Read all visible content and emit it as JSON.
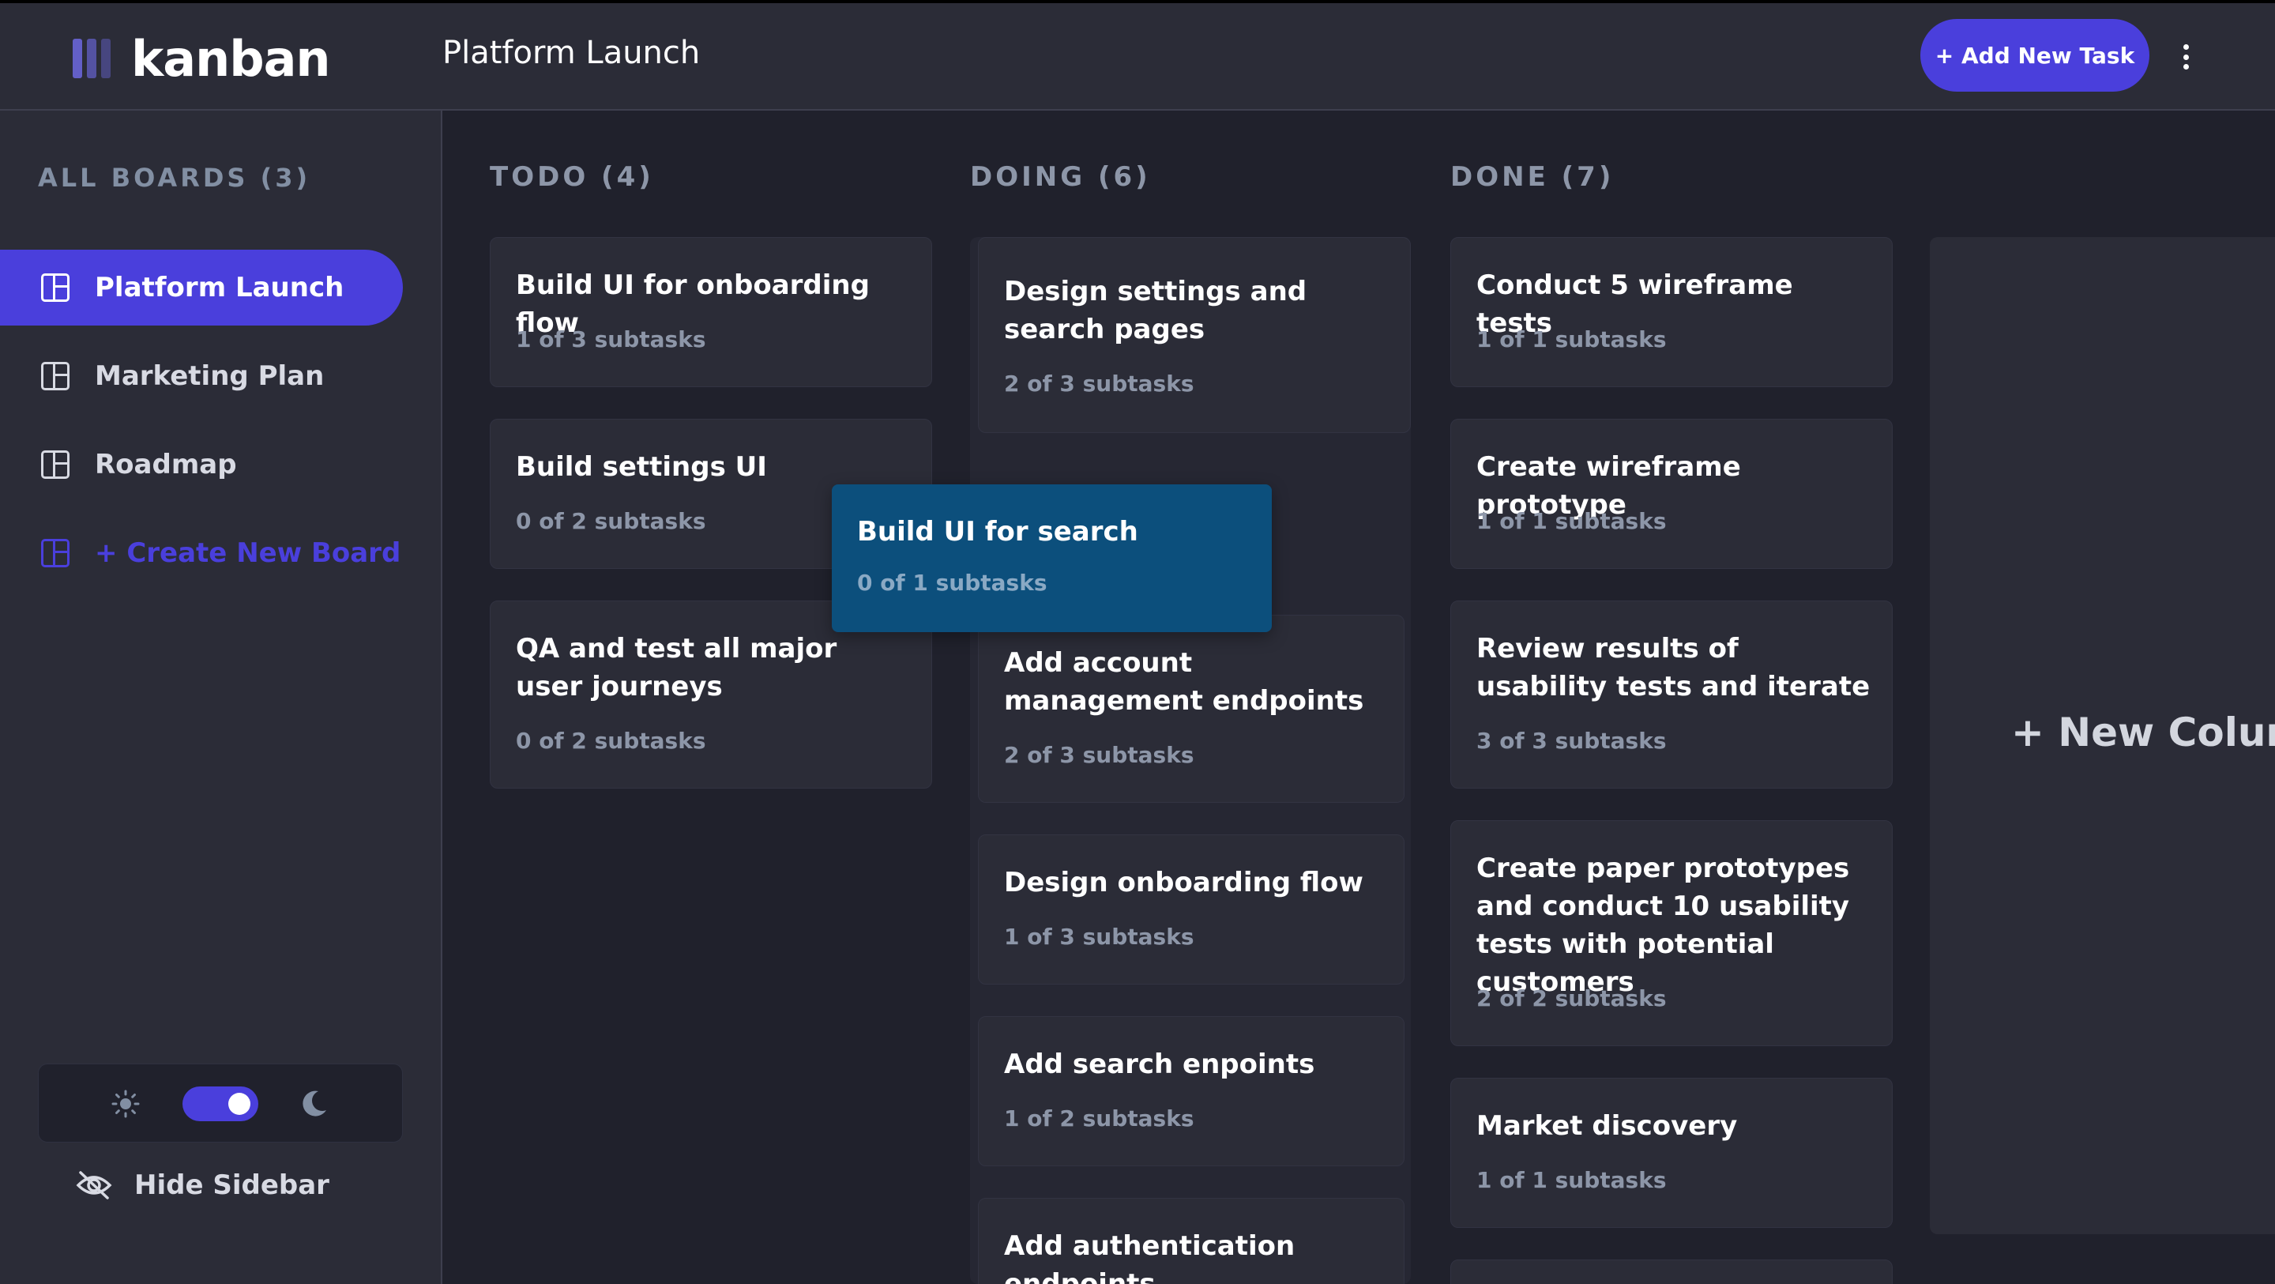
{
  "header": {
    "logo_text": "kanban",
    "board_title": "Platform Launch",
    "add_task_label": "+ Add New Task"
  },
  "sidebar": {
    "all_boards_label": "ALL BOARDS (3)",
    "boards": [
      "Platform Launch",
      "Marketing Plan",
      "Roadmap"
    ],
    "create_label": "+ Create New Board",
    "hide_label": "Hide Sidebar",
    "theme_mode": "dark"
  },
  "columns": [
    {
      "title": "TODO (4)",
      "cards": [
        {
          "title": "Build UI for onboarding flow",
          "sub": "1 of 3 subtasks"
        },
        {
          "title": "Build settings UI",
          "sub": "0 of 2 subtasks"
        },
        {
          "title": "QA and test all major user journeys",
          "sub": "0 of 2 subtasks"
        }
      ]
    },
    {
      "title": "DOING (6)",
      "cards": [
        {
          "title": "Design settings and search pages",
          "sub": "2 of 3 subtasks"
        },
        {
          "title": "Add account management endpoints",
          "sub": "2 of 3 subtasks"
        },
        {
          "title": "Design onboarding flow",
          "sub": "1 of 3 subtasks"
        },
        {
          "title": "Add search enpoints",
          "sub": "1 of 2 subtasks"
        },
        {
          "title": "Add authentication endpoints",
          "sub": ""
        }
      ]
    },
    {
      "title": "DONE (7)",
      "cards": [
        {
          "title": "Conduct 5 wireframe tests",
          "sub": "1 of 1 subtasks"
        },
        {
          "title": "Create wireframe prototype",
          "sub": "1 of 1 subtasks"
        },
        {
          "title": "Review results of usability tests and iterate",
          "sub": "3 of 3 subtasks"
        },
        {
          "title": "Create paper prototypes and conduct 10 usability tests with potential customers",
          "sub": "2 of 2 subtasks"
        },
        {
          "title": "Market discovery",
          "sub": "1 of 1 subtasks"
        }
      ]
    }
  ],
  "dragging_card": {
    "title": "Build UI for search",
    "sub": "0 of 1 subtasks"
  },
  "new_column_label": "+ New Column",
  "colors": {
    "accent": "#4a3fdc",
    "drag_card": "#0c4f7c",
    "bg": "#20212c",
    "panel": "#2b2c37"
  }
}
